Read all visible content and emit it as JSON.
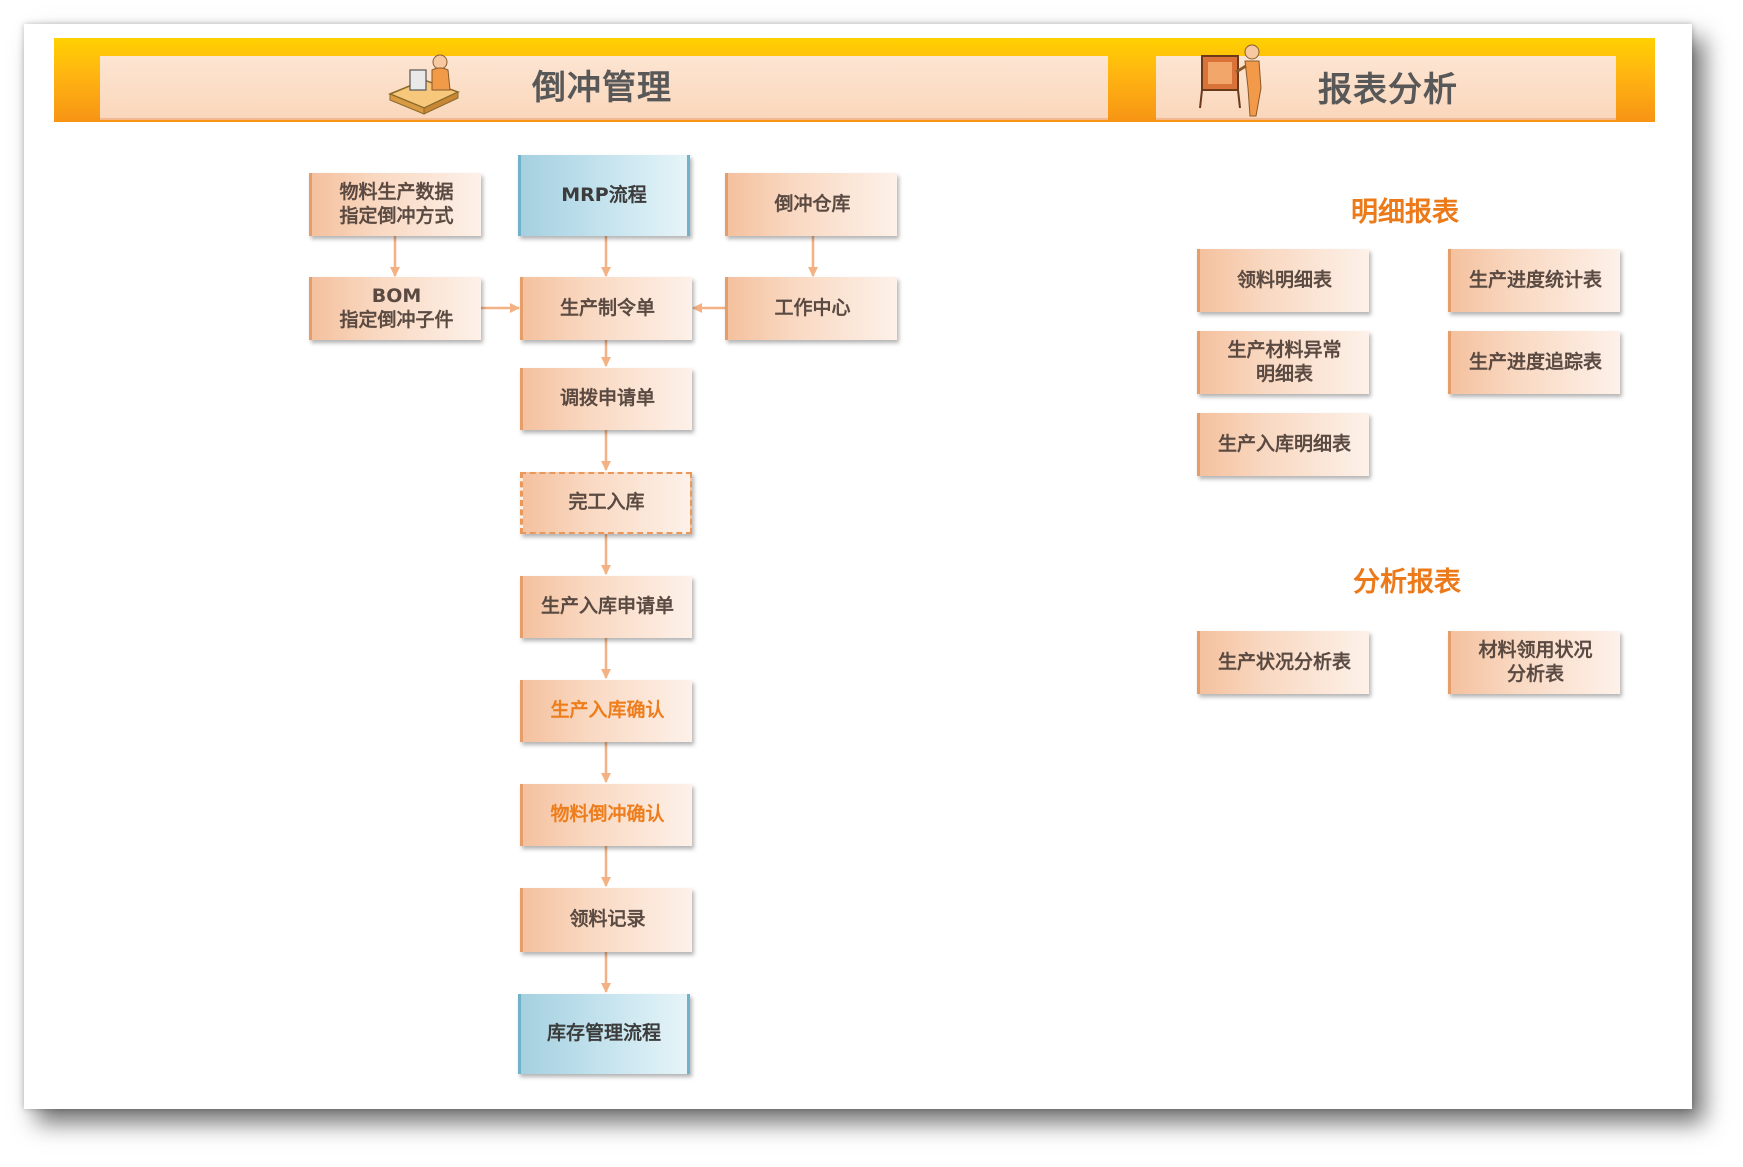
{
  "header": {
    "left_title": "倒冲管理",
    "right_title": "报表分析",
    "left_icon": "person-at-desk-icon",
    "right_icon": "person-presenting-board-icon"
  },
  "flow": {
    "material_prod_data": "物料生产数据\n指定倒冲方式",
    "mrp": "MRP流程",
    "backflush_warehouse": "倒冲仓库",
    "bom": "BOM\n指定倒冲子件",
    "production_order": "生产制令单",
    "work_center": "工作中心",
    "transfer_request": "调拨申请单",
    "completion_stock_in": "完工入库",
    "prod_stock_in_request": "生产入库申请单",
    "prod_stock_in_confirm": "生产入库确认",
    "material_backflush_confirm": "物料倒冲确认",
    "material_issue_record": "领料记录",
    "inventory_flow": "库存管理流程"
  },
  "reports": {
    "detail_title": "明细报表",
    "detail_items": [
      "领料明细表",
      "生产进度统计表",
      "生产材料异常\n明细表",
      "生产进度追踪表",
      "生产入库明细表"
    ],
    "analysis_title": "分析报表",
    "analysis_items": [
      "生产状况分析表",
      "材料领用状况\n分析表"
    ]
  },
  "colors": {
    "header_gradient_top": "#ffd100",
    "header_gradient_bottom": "#f79414",
    "box_fill": "#f9d8c1",
    "box_blue": "#c4e3ee",
    "arrow": "#f4b183",
    "accent_text": "#ec7a1a"
  }
}
